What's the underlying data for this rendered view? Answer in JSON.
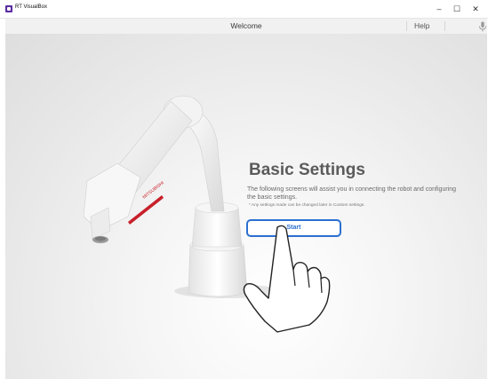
{
  "window": {
    "title": "RT VisualBox",
    "minimize": "–",
    "maximize": "☐",
    "close": "✕"
  },
  "header": {
    "title": "Welcome",
    "help_label": "Help",
    "mic_icon": "microphone-icon"
  },
  "main": {
    "heading": "Basic Settings",
    "description": "The following screens will assist you in connecting the robot and configuring the basic settings.",
    "note": "* Any settings made can be changed later in Custom settings.",
    "start_label": "Start",
    "robot_logo": "MITSUBISHI"
  },
  "colors": {
    "accent": "#2b6fd1",
    "heading": "#5b5b5b",
    "logo_red": "#c8202a"
  }
}
